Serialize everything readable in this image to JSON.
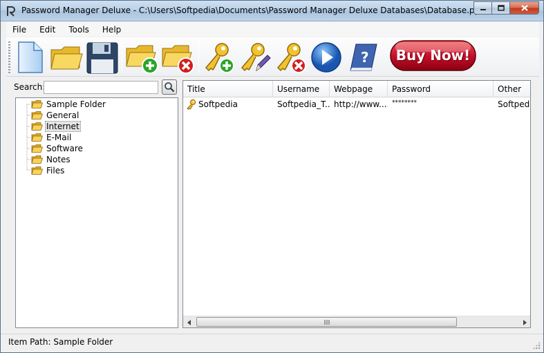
{
  "window": {
    "title": "Password Manager Deluxe - C:\\Users\\Softpedia\\Documents\\Password Manager Deluxe Databases\\Database.ppd"
  },
  "menu": {
    "items": [
      {
        "label": "File"
      },
      {
        "label": "Edit"
      },
      {
        "label": "Tools"
      },
      {
        "label": "Help"
      }
    ]
  },
  "toolbar": {
    "buttons": [
      {
        "icon": "new-document-icon"
      },
      {
        "icon": "open-folder-icon"
      },
      {
        "icon": "save-disk-icon"
      },
      {
        "icon": "add-folder-icon"
      },
      {
        "icon": "delete-folder-icon"
      },
      {
        "icon": "add-key-icon"
      },
      {
        "icon": "edit-key-icon"
      },
      {
        "icon": "delete-key-icon"
      },
      {
        "icon": "play-icon"
      },
      {
        "icon": "help-book-icon"
      }
    ],
    "buy_label": "Buy Now!"
  },
  "search": {
    "label": "Search:",
    "value": ""
  },
  "tree": {
    "items": [
      {
        "label": "Sample Folder",
        "selected": false
      },
      {
        "label": "General",
        "selected": false
      },
      {
        "label": "Internet",
        "selected": true
      },
      {
        "label": "E-Mail",
        "selected": false
      },
      {
        "label": "Software",
        "selected": false
      },
      {
        "label": "Notes",
        "selected": false
      },
      {
        "label": "Files",
        "selected": false
      }
    ]
  },
  "list": {
    "columns": [
      "Title",
      "Username",
      "Webpage",
      "Password",
      "Other"
    ],
    "rows": [
      {
        "title": "Softpedia",
        "username": "Softpedia_T...",
        "webpage": "http://www....",
        "password": "********",
        "other": "Softpedia"
      }
    ]
  },
  "status": {
    "text": "Item Path: Sample Folder"
  },
  "colors": {
    "buy_button": "#c8102e",
    "title_bar": "#b7cfe6",
    "close_button": "#c1381a"
  }
}
